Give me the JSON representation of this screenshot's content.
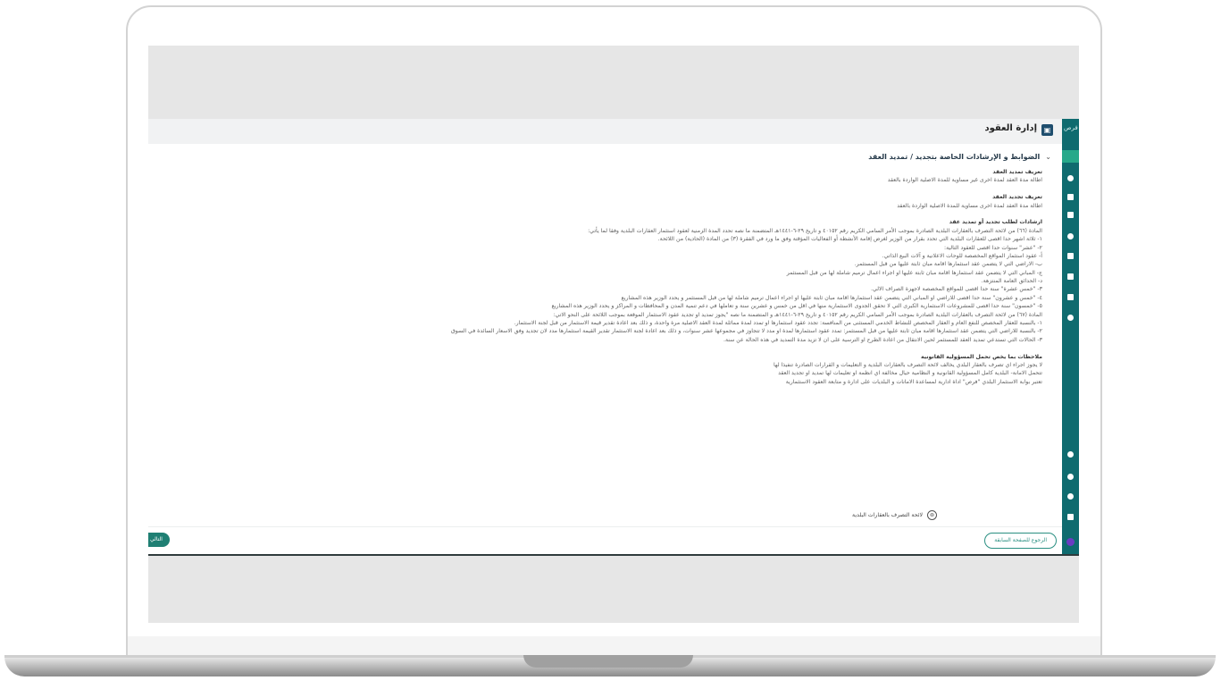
{
  "app": {
    "title": "إدارة العقود",
    "rail_logo": "فرص",
    "section_title": "الضوابط و الإرشادات الخاصة بتجديد / تمديد العقد",
    "lines": [
      {
        "text": "تعريف تمديد العقد",
        "bold": true
      },
      {
        "text": "اطالة مدة العقد لمدة اخرى غير مساوية للمدة الاصلية الواردة بالعقد",
        "bold": false
      },
      {
        "text": "",
        "bold": false
      },
      {
        "text": "تعريف تجديد العقد",
        "bold": true
      },
      {
        "text": "اطالة مدة العقد لمدة اخرى مساوية للمدة الاصلية الواردة بالعقد",
        "bold": false
      },
      {
        "text": "",
        "bold": false
      },
      {
        "text": "ارشادات لطلب تجديد أو تمديد عقد",
        "bold": true
      },
      {
        "text": "المادة (٦٦) من لائحة التصرف بالعقارات البلدية الصادرة بموجب الأمر السامي الكريم رقم ٤٠١٥٢ و تاريخ ٢٩-٦-١٤٤١هـ المتضمنة ما نصه تحدد المدة الزمنية لعقود استثمار العقارات البلدية وفقا لما يأتي:",
        "bold": false
      },
      {
        "text": "١- ثلاثة اشهر حدا اقصى للعقارات البلدية التي تحدد بقرار من الوزير لغرض إقامة الأنشطة أو الفعاليات المؤقتة وفق ما ورد في الفقرة (٣) من المادة (الحادية) من اللائحة.",
        "bold": false
      },
      {
        "text": "٢- \"عشر\" سنوات حدا اقصى للعقود التالية:",
        "bold": false
      },
      {
        "text": "أ- عقود استثمار المواقع المخصصة للوحات الاعلانية و آلات البيع الذاتي.",
        "bold": false
      },
      {
        "text": "ب- الاراضي التي لا يتضمن عقد استثمارها اقامة مبان ثابتة عليها من قبل المستثمر.",
        "bold": false
      },
      {
        "text": "ج- المباني التي لا يتضمن عقد استثمارها اقامة مبان ثابتة عليها او اجراء اعمال ترميم شاملة لها من قبل المستثمر",
        "bold": false
      },
      {
        "text": "د- الحدائق العامة المنتزهة.",
        "bold": false
      },
      {
        "text": "٣- \"خمس عشرة\" سنة حدا اقصى للمواقع المخصصة لاجهزة الصراف الالي.",
        "bold": false
      },
      {
        "text": "٤- \"خمس و عشرون\" سنة حدا اقصى للاراضي او المباني التي يتضمن عقد استثمارها اقامة مبان ثابتة عليها او اجراء اعمال ترميم شاملة لها من قبل المستثمر و يحدد الوزير هذه المشاريع",
        "bold": false
      },
      {
        "text": "٥- \"خمسون\" سنة حدا اقصى للمشروعات الاستثمارية الكبرى التي لا تحقق الجدوى الاستثمارية منها في اقل من خمس و عشرين سنة و تعاملها في دعم تنمية المدن و المحافظات و المراكز و يحدد الوزير هذه المشاريع",
        "bold": false
      },
      {
        "text": "المادة (٦٧) من لائحة التصرف بالعقارات البلدية الصادرة بموجب الأمر السامي الكريم رقم ٤٠١٥٢ و تاريخ ٢٩-٦-١٤٤١هـ و المتضمنة ما نصه \"يجوز تمديد او تجديد عقود الاستثمار الموقعة بموجب اللائحة على النحو الاتي:",
        "bold": false
      },
      {
        "text": "١- بالنسبة للعقار المخصص للنفع العام و العقار المخصص للنشاط الخدمي المستثنى من المنافسة: تجدد عقود استثمارها او تمدد لمدة مماثلة لمدة العقد الاصلية مرة واحدة، و ذلك بعد اعادة تقدير قيمة الاستثمار من قبل لجنة الاستثمار.",
        "bold": false
      },
      {
        "text": "٢- بالنسبة للاراضي التي يتضمن عقد استثمارها اقامة مبان ثابتة عليها من قبل المستثمر: تمدد عقود استثمارها لمدة او مدد لا تتجاوز في مجموعها عشر سنوات، و ذلك بعد اعادة لجنة الاستثمار تقدير القيمة استثمارها مدد لان تجديد وفق الاسعار السائدة في السوق",
        "bold": false
      },
      {
        "text": "٣- الحالات التي تستدعي تمديد العقد للمستثمر لحين الانتقال من اعادة الطرح او الترسية على ان لا تزيد مدة التمديد في هذه الحالة عن سنة.",
        "bold": false
      },
      {
        "text": "",
        "bold": false
      },
      {
        "text": "ملاحظات بما يخص تحمل المسؤولية القانونية",
        "bold": true
      },
      {
        "text": "لا يجوز اجراء اي تصرف بالعقار البلدي يخالف لائحة التصرف بالعقارات البلدية و التعليمات و القرارات الصادرة تنفيذا لها",
        "bold": false
      },
      {
        "text": "تتحمل الامانة- البلدية كامل المسؤولية القانونية و النظامية حيال مخالفة اي انظمة او تعليمات لها تمديد او تجديد العقد",
        "bold": false
      },
      {
        "text": "تعتبر بوابة الاستثمار البلدي \"فرص\" اداة ادارية لمساعدة الامانات و البلديات على ادارة و متابعة العقود الاستثمارية",
        "bold": false
      }
    ],
    "attachment_label": "لائحة التصرف بالعقارات البلدية",
    "back_button": "الرجوع للصفحة السابقة",
    "next_button": "التالي"
  },
  "colors": {
    "rail": "#0f6b6f",
    "accent": "#2a8f82",
    "primary_button": "#1f7f73"
  }
}
